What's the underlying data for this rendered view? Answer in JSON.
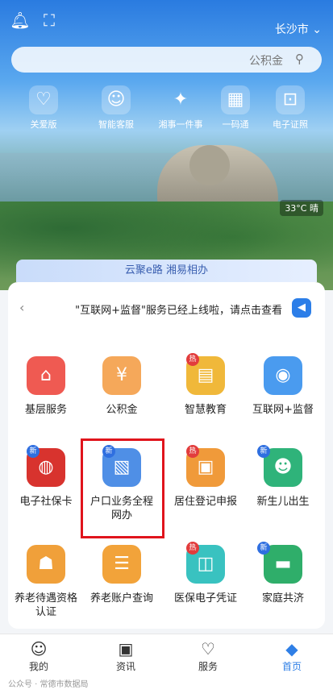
{
  "topbar": {
    "city": "长沙市",
    "city_chevron": "chevron-down-icon",
    "bell_icon": "bell-icon",
    "scan_icon": "scan-icon"
  },
  "search": {
    "placeholder": "公积金",
    "icon": "search-icon"
  },
  "quick_links": [
    {
      "label": "电子证照",
      "icon": "id-card-icon",
      "glyph": "⊡"
    },
    {
      "label": "一码通",
      "icon": "qr-grid-icon",
      "glyph": "▦"
    },
    {
      "label": "湘事一件事",
      "icon": "banner-icon",
      "glyph": "✦"
    },
    {
      "label": "智能客服",
      "icon": "robot-icon",
      "glyph": "☺"
    },
    {
      "label": "关爱版",
      "icon": "heart-icon",
      "glyph": "♡"
    }
  ],
  "weather": {
    "text": "33°C 晴"
  },
  "yun_banner": {
    "text": "云聚e路 湘易相办"
  },
  "notice": {
    "text": "\"互联网+监督\"服务已经上线啦，请点击查看",
    "icon": "speaker-icon",
    "arrow": "chevron-left-icon"
  },
  "services": [
    {
      "label": "互联网+监督",
      "icon": "eye-icon",
      "glyph": "◉",
      "color": "#4a9bef",
      "badge": ""
    },
    {
      "label": "智慧教育",
      "icon": "book-icon",
      "glyph": "▤",
      "color": "#f0b83a",
      "badge": "热"
    },
    {
      "label": "公积金",
      "icon": "house-fund-icon",
      "glyph": "¥",
      "color": "#f5a85a",
      "badge": ""
    },
    {
      "label": "基层服务",
      "icon": "home-heart-icon",
      "glyph": "⌂",
      "color": "#ef5a52",
      "badge": ""
    },
    {
      "label": "新生儿出生",
      "icon": "baby-icon",
      "glyph": "☻",
      "color": "#2fb37a",
      "badge": "新"
    },
    {
      "label": "居住登记申报",
      "icon": "id-register-icon",
      "glyph": "▣",
      "color": "#f09a3a",
      "badge": "热"
    },
    {
      "label": "户口业务全程网办",
      "icon": "document-icon",
      "glyph": "▧",
      "color": "#4f8fe6",
      "badge": "新"
    },
    {
      "label": "电子社保卡",
      "icon": "social-security-icon",
      "glyph": "◍",
      "color": "#d8332e",
      "badge": "新"
    },
    {
      "label": "家庭共济",
      "icon": "card-icon",
      "glyph": "▬",
      "color": "#2fae6a",
      "badge": "新"
    },
    {
      "label": "医保电子凭证",
      "icon": "medical-card-icon",
      "glyph": "◫",
      "color": "#39c2c0",
      "badge": "热"
    },
    {
      "label": "养老账户查询",
      "icon": "pension-account-icon",
      "glyph": "☰",
      "color": "#f2a33a",
      "badge": ""
    },
    {
      "label": "养老待遇资格认证",
      "icon": "pension-person-icon",
      "glyph": "☗",
      "color": "#f0a03a",
      "badge": ""
    }
  ],
  "tabs": [
    {
      "label": "首页",
      "icon": "home-icon",
      "glyph": "◆",
      "active": true
    },
    {
      "label": "服务",
      "icon": "service-icon",
      "glyph": "♡",
      "active": false
    },
    {
      "label": "资讯",
      "icon": "news-icon",
      "glyph": "▣",
      "active": false
    },
    {
      "label": "我的",
      "icon": "profile-icon",
      "glyph": "☺",
      "active": false
    }
  ],
  "watermark": "公众号 · 常德市数据局"
}
